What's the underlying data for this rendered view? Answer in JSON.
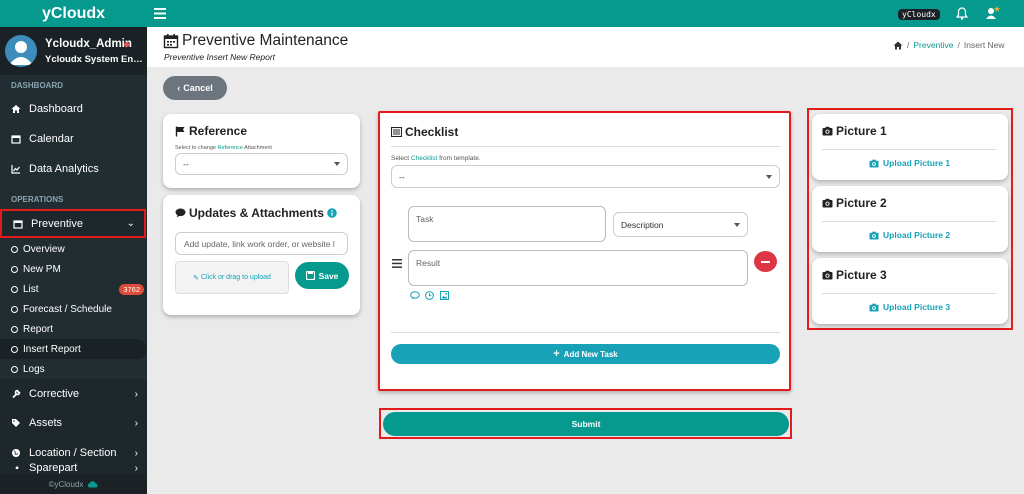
{
  "app": {
    "brand": "yCloudx",
    "user_name": "Ycloudx_Admin",
    "user_role": "Ycloudx System Engin...",
    "footer": "©yCloudx"
  },
  "topbar": {
    "tag": "yCloudx"
  },
  "sidebar": {
    "sections": {
      "dashboard": "DASHBOARD",
      "operations": "OPERATIONS"
    },
    "items": [
      {
        "label": "Dashboard",
        "icon": "home-icon"
      },
      {
        "label": "Calendar",
        "icon": "calendar-icon"
      },
      {
        "label": "Data Analytics",
        "icon": "chart-icon"
      },
      {
        "label": "Preventive",
        "icon": "calendar-icon",
        "active": true
      },
      {
        "label": "Corrective",
        "icon": "wrench-icon"
      },
      {
        "label": "Assets",
        "icon": "tag-icon"
      },
      {
        "label": "Location / Section",
        "icon": "globe-icon"
      },
      {
        "label": "Sparepart",
        "icon": "cart-icon"
      }
    ],
    "preventive_sub": [
      {
        "label": "Overview"
      },
      {
        "label": "New PM"
      },
      {
        "label": "List",
        "badge": "3762"
      },
      {
        "label": "Forecast / Schedule"
      },
      {
        "label": "Report"
      },
      {
        "label": "Insert Report",
        "active": true
      },
      {
        "label": "Logs"
      }
    ]
  },
  "header": {
    "title": "Preventive Maintenance",
    "subtitle": "Preventive Insert New Report"
  },
  "breadcrumb": {
    "level1": "Preventive",
    "level2": "Insert New",
    "sep": "/"
  },
  "buttons": {
    "cancel": "Cancel",
    "save": "Save",
    "add_task": "Add New Task",
    "submit": "Submit"
  },
  "reference": {
    "title": "Reference",
    "hint_pre": "Select to change",
    "hint_link": "Reference",
    "hint_post": "Attachment",
    "value": "--"
  },
  "updates": {
    "title": "Updates & Attachments",
    "placeholder": "Add update, link work order, or website l",
    "upload": "Click or drag to upload"
  },
  "checklist": {
    "title": "Checklist",
    "hint_pre": "Select",
    "hint_link": "Checklist",
    "hint_post": "from template.",
    "template_value": "--",
    "task_placeholder": "Task",
    "description_value": "Description",
    "result_placeholder": "Result"
  },
  "pictures": [
    {
      "title": "Picture 1",
      "link": "Upload Picture 1"
    },
    {
      "title": "Picture 2",
      "link": "Upload Picture 2"
    },
    {
      "title": "Picture 3",
      "link": "Upload Picture 3"
    }
  ],
  "colors": {
    "brand": "#069a8e",
    "sidebar": "#222d32",
    "accent_blue": "#17a2b8",
    "danger": "#dc3545",
    "highlight": "#e31b1b"
  }
}
